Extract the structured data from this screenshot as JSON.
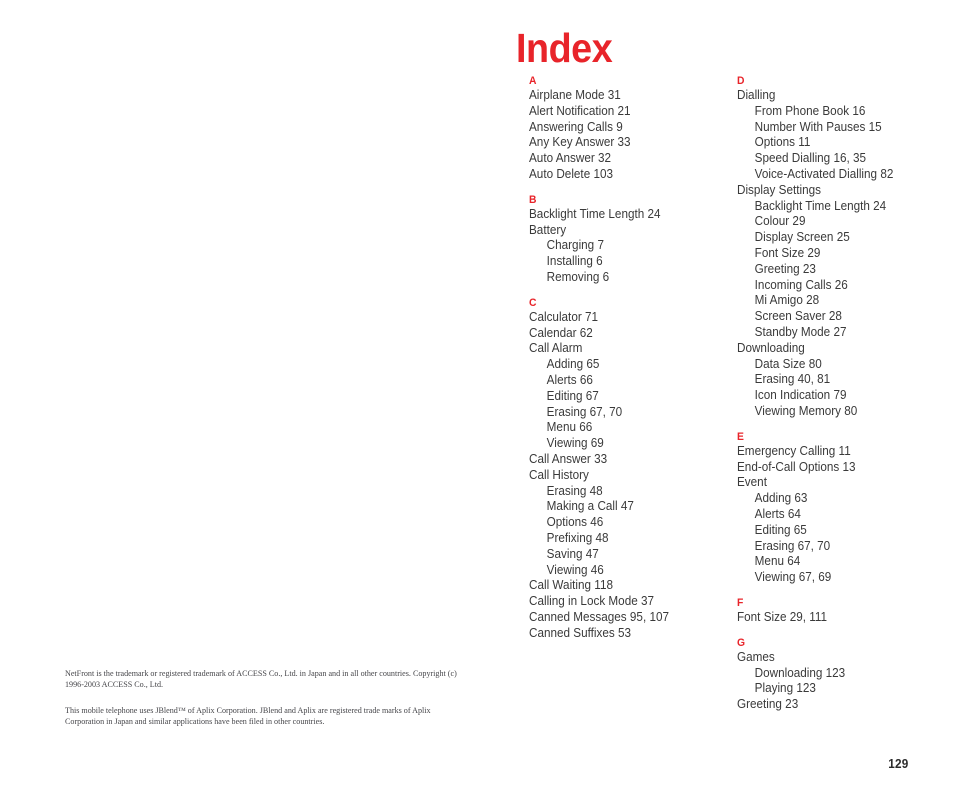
{
  "title": "Index",
  "accent_color": "#e8242a",
  "text_color": "#3a3a3a",
  "page_number": "129",
  "columns": [
    {
      "sections": [
        {
          "letter": "A",
          "entries": [
            {
              "text": "Airplane Mode 31",
              "level": 0
            },
            {
              "text": "Alert Notification 21",
              "level": 0
            },
            {
              "text": "Answering Calls 9",
              "level": 0
            },
            {
              "text": "Any Key Answer 33",
              "level": 0
            },
            {
              "text": "Auto Answer 32",
              "level": 0
            },
            {
              "text": "Auto Delete 103",
              "level": 0
            }
          ]
        },
        {
          "letter": "B",
          "entries": [
            {
              "text": "Backlight Time Length 24",
              "level": 0
            },
            {
              "text": "Battery",
              "level": 0
            },
            {
              "text": "Charging 7",
              "level": 1
            },
            {
              "text": "Installing 6",
              "level": 1
            },
            {
              "text": "Removing 6",
              "level": 1
            }
          ]
        },
        {
          "letter": "C",
          "entries": [
            {
              "text": "Calculator 71",
              "level": 0
            },
            {
              "text": "Calendar 62",
              "level": 0
            },
            {
              "text": "Call Alarm",
              "level": 0
            },
            {
              "text": "Adding 65",
              "level": 1
            },
            {
              "text": "Alerts 66",
              "level": 1
            },
            {
              "text": "Editing 67",
              "level": 1
            },
            {
              "text": "Erasing 67, 70",
              "level": 1
            },
            {
              "text": "Menu 66",
              "level": 1
            },
            {
              "text": "Viewing 69",
              "level": 1
            },
            {
              "text": "Call Answer 33",
              "level": 0
            },
            {
              "text": "Call History",
              "level": 0
            },
            {
              "text": "Erasing 48",
              "level": 1
            },
            {
              "text": "Making a Call 47",
              "level": 1
            },
            {
              "text": "Options 46",
              "level": 1
            },
            {
              "text": "Prefixing 48",
              "level": 1
            },
            {
              "text": "Saving 47",
              "level": 1
            },
            {
              "text": "Viewing 46",
              "level": 1
            },
            {
              "text": "Call Waiting 118",
              "level": 0
            },
            {
              "text": "Calling in Lock Mode 37",
              "level": 0
            },
            {
              "text": "Canned Messages 95, 107",
              "level": 0
            },
            {
              "text": "Canned Suffixes 53",
              "level": 0
            }
          ]
        }
      ]
    },
    {
      "sections": [
        {
          "letter": "D",
          "entries": [
            {
              "text": "Dialling",
              "level": 0
            },
            {
              "text": "From Phone Book 16",
              "level": 1
            },
            {
              "text": "Number With Pauses 15",
              "level": 1
            },
            {
              "text": "Options 11",
              "level": 1
            },
            {
              "text": "Speed Dialling 16, 35",
              "level": 1
            },
            {
              "text": "Voice-Activated Dialling 82",
              "level": 1
            },
            {
              "text": "Display Settings",
              "level": 0
            },
            {
              "text": "Backlight Time Length 24",
              "level": 1
            },
            {
              "text": "Colour 29",
              "level": 1
            },
            {
              "text": "Display Screen 25",
              "level": 1
            },
            {
              "text": "Font Size 29",
              "level": 1
            },
            {
              "text": "Greeting 23",
              "level": 1
            },
            {
              "text": "Incoming Calls 26",
              "level": 1
            },
            {
              "text": "Mi Amigo 28",
              "level": 1
            },
            {
              "text": "Screen Saver 28",
              "level": 1
            },
            {
              "text": "Standby Mode 27",
              "level": 1
            },
            {
              "text": "Downloading",
              "level": 0
            },
            {
              "text": "Data Size 80",
              "level": 1
            },
            {
              "text": "Erasing 40, 81",
              "level": 1
            },
            {
              "text": "Icon Indication 79",
              "level": 1
            },
            {
              "text": "Viewing Memory 80",
              "level": 1
            }
          ]
        },
        {
          "letter": "E",
          "entries": [
            {
              "text": "Emergency Calling 11",
              "level": 0
            },
            {
              "text": "End-of-Call Options 13",
              "level": 0
            },
            {
              "text": "Event",
              "level": 0
            },
            {
              "text": "Adding 63",
              "level": 1
            },
            {
              "text": "Alerts 64",
              "level": 1
            },
            {
              "text": "Editing 65",
              "level": 1
            },
            {
              "text": "Erasing 67, 70",
              "level": 1
            },
            {
              "text": "Menu 64",
              "level": 1
            },
            {
              "text": "Viewing 67, 69",
              "level": 1
            }
          ]
        },
        {
          "letter": "F",
          "entries": [
            {
              "text": "Font Size 29, 111",
              "level": 0
            }
          ]
        },
        {
          "letter": "G",
          "entries": [
            {
              "text": "Games",
              "level": 0
            },
            {
              "text": "Downloading 123",
              "level": 1
            },
            {
              "text": "Playing 123",
              "level": 1
            },
            {
              "text": "Greeting 23",
              "level": 0
            }
          ]
        }
      ]
    }
  ],
  "footnotes": [
    "NetFront is the trademark or registered trademark of ACCESS Co., Ltd. in Japan and in all other countries. Copyright (c) 1996-2003 ACCESS Co., Ltd.",
    "This mobile telephone uses JBlend™ of Aplix Corporation. JBlend and Aplix are registered trade marks of Aplix Corporation in Japan and similar applications have been filed in other countries."
  ]
}
